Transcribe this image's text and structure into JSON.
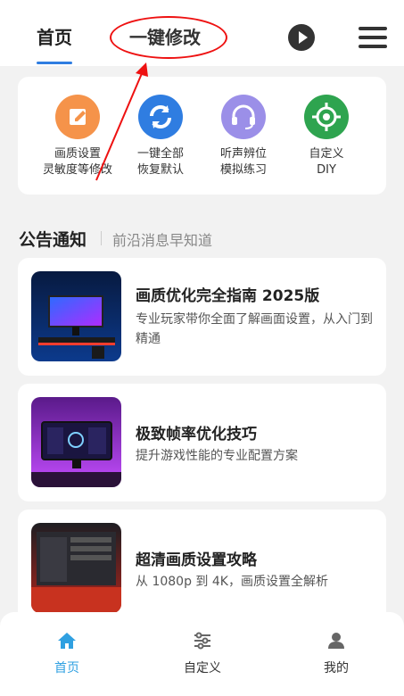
{
  "header": {
    "tab_home": "首页",
    "tab_one_click_modify": "一键修改",
    "icons": [
      "play-icon",
      "menu-icon"
    ]
  },
  "quick_actions": [
    {
      "line1": "画质设置",
      "line2": "灵敏度等修改",
      "icon": "edit-icon",
      "color": "#f5934a"
    },
    {
      "line1": "一键全部",
      "line2": "恢复默认",
      "icon": "refresh-icon",
      "color": "#2f7de1"
    },
    {
      "line1": "听声辨位",
      "line2": "模拟练习",
      "icon": "headset-icon",
      "color": "#9b8fe8"
    },
    {
      "line1": "自定义",
      "line2": "DIY",
      "icon": "target-icon",
      "color": "#2ea44f"
    }
  ],
  "announcements": {
    "title": "公告通知",
    "subtitle": "前沿消息早知道",
    "items": [
      {
        "title": "画质优化完全指南 2025版",
        "desc": "专业玩家带你全面了解画面设置，从入门到精通"
      },
      {
        "title": "极致帧率优化技巧",
        "desc": "提升游戏性能的专业配置方案"
      },
      {
        "title": "超清画质设置攻略",
        "desc": "从 1080p 到 4K，画质设置全解析"
      }
    ]
  },
  "bottom_nav": [
    {
      "label": "首页",
      "icon": "home-icon",
      "active": true
    },
    {
      "label": "自定义",
      "icon": "sliders-icon",
      "active": false
    },
    {
      "label": "我的",
      "icon": "user-icon",
      "active": false
    }
  ],
  "colors": {
    "accent": "#2f7de1",
    "annotation": "#e11111"
  }
}
